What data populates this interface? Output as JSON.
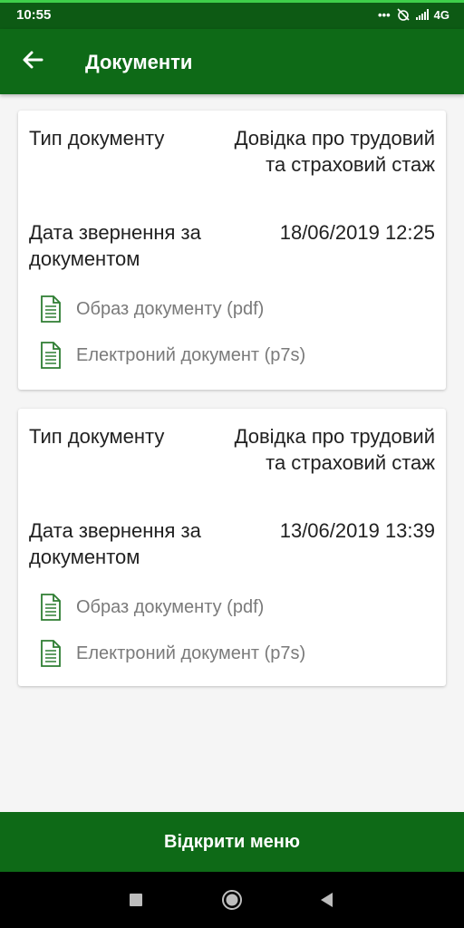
{
  "status": {
    "time": "10:55",
    "network": "4G"
  },
  "header": {
    "title": "Документи"
  },
  "documents": [
    {
      "type_label": "Тип документу",
      "type_value": "Довідка про трудовий та страховий стаж",
      "date_label": "Дата звернення за документом",
      "date_value": "18/06/2019 12:25",
      "links": [
        "Образ документу (pdf)",
        "Електроний документ (p7s)"
      ]
    },
    {
      "type_label": "Тип документу",
      "type_value": "Довідка про трудовий та страховий стаж",
      "date_label": "Дата звернення за документом",
      "date_value": "13/06/2019 13:39",
      "links": [
        "Образ документу (pdf)",
        "Електроний документ (p7s)"
      ]
    }
  ],
  "footer": {
    "open_menu_label": "Відкрити меню"
  },
  "colors": {
    "primary": "#0e6a17",
    "status_bar": "#0d5a14",
    "icon_green": "#2e7d32",
    "link_gray": "#7a7a7a"
  },
  "icons": [
    "back-arrow-icon",
    "document-icon",
    "square-icon",
    "circle-icon",
    "triangle-back-icon"
  ]
}
